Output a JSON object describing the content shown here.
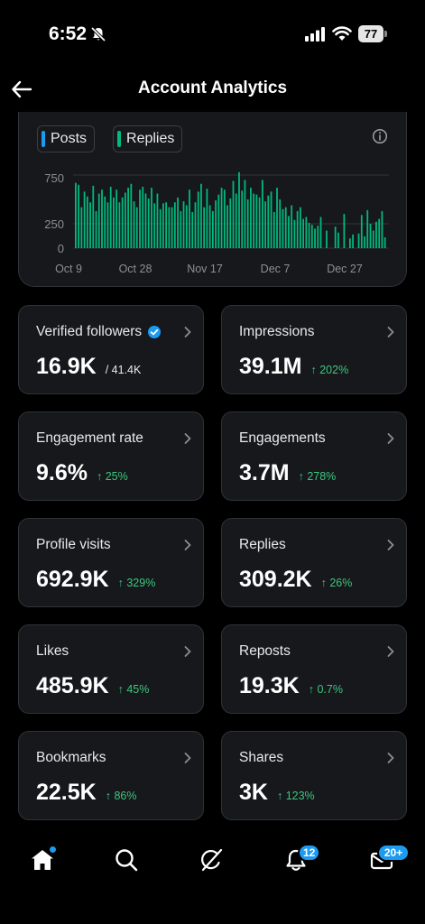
{
  "status_bar": {
    "time": "6:52",
    "battery": "77"
  },
  "header": {
    "title": "Account Analytics"
  },
  "chart": {
    "legend": [
      {
        "label": "Posts",
        "color": "#1d9bf0"
      },
      {
        "label": "Replies",
        "color": "#00ba7c"
      }
    ],
    "y_ticks": [
      "750",
      "250",
      "0"
    ],
    "x_ticks": [
      "Oct 9",
      "Oct 28",
      "Nov 17",
      "Dec 7",
      "Dec 27"
    ]
  },
  "chart_data": {
    "type": "bar",
    "title": "",
    "xlabel": "",
    "ylabel": "",
    "ylim": [
      0,
      750
    ],
    "x_tick_labels": [
      "Oct 9",
      "Oct 28",
      "Nov 17",
      "Dec 7",
      "Dec 27"
    ],
    "series": [
      {
        "name": "Posts",
        "color": "#1d9bf0",
        "values": [
          0,
          0,
          0,
          0,
          0,
          0,
          0,
          0,
          0,
          0,
          0,
          0,
          0,
          0,
          0,
          0,
          0,
          0,
          0,
          0,
          0,
          0,
          0,
          0,
          0,
          0,
          0,
          0,
          0,
          0,
          0,
          0,
          0,
          0,
          0,
          0,
          0,
          0,
          0,
          0,
          0,
          0,
          0,
          0,
          0,
          0,
          0,
          0,
          0,
          0,
          0,
          0,
          0,
          0,
          0,
          0,
          0,
          0,
          0,
          0,
          0,
          0,
          0,
          0,
          0,
          0,
          0,
          0,
          0,
          0,
          0,
          0,
          0,
          0,
          0,
          0,
          0,
          0,
          0,
          0,
          0,
          0,
          0,
          0,
          0,
          0,
          0,
          0,
          0,
          0,
          0,
          0,
          0,
          0
        ]
      },
      {
        "name": "Replies",
        "color": "#00ba7c",
        "values": [
          670,
          650,
          420,
          580,
          530,
          470,
          640,
          380,
          560,
          600,
          530,
          470,
          630,
          520,
          600,
          470,
          520,
          570,
          620,
          660,
          480,
          420,
          600,
          630,
          560,
          510,
          620,
          460,
          560,
          400,
          460,
          470,
          420,
          420,
          470,
          520,
          380,
          480,
          440,
          600,
          370,
          470,
          580,
          660,
          420,
          610,
          440,
          380,
          490,
          550,
          620,
          600,
          440,
          510,
          690,
          560,
          780,
          590,
          700,
          500,
          620,
          560,
          550,
          520,
          700,
          480,
          540,
          580,
          370,
          620,
          500,
          400,
          420,
          330,
          440,
          290,
          380,
          420,
          300,
          320,
          260,
          240,
          200,
          230,
          320,
          0,
          180,
          0,
          0,
          220,
          160,
          0,
          350,
          0,
          100,
          140,
          0,
          150,
          340,
          120,
          390,
          250,
          180,
          270,
          300,
          380,
          110
        ]
      }
    ]
  },
  "metrics": [
    {
      "label": "Verified followers",
      "value": "16.9K",
      "total": "/ 41.4K",
      "change": "",
      "verified": true
    },
    {
      "label": "Impressions",
      "value": "39.1M",
      "total": "",
      "change": "↑ 202%"
    },
    {
      "label": "Engagement rate",
      "value": "9.6%",
      "total": "",
      "change": "↑ 25%"
    },
    {
      "label": "Engagements",
      "value": "3.7M",
      "total": "",
      "change": "↑ 278%"
    },
    {
      "label": "Profile visits",
      "value": "692.9K",
      "total": "",
      "change": "↑ 329%"
    },
    {
      "label": "Replies",
      "value": "309.2K",
      "total": "",
      "change": "↑ 26%"
    },
    {
      "label": "Likes",
      "value": "485.9K",
      "total": "",
      "change": "↑ 45%"
    },
    {
      "label": "Reposts",
      "value": "19.3K",
      "total": "",
      "change": "↑ 0.7%"
    },
    {
      "label": "Bookmarks",
      "value": "22.5K",
      "total": "",
      "change": "↑ 86%"
    },
    {
      "label": "Shares",
      "value": "3K",
      "total": "",
      "change": "↑ 123%"
    }
  ],
  "nav": {
    "items": [
      "home-icon",
      "search-icon",
      "grok-icon",
      "notifications-icon",
      "messages-icon"
    ],
    "notifications_badge": "12",
    "messages_badge": "20+",
    "accent": "#1d9bf0"
  }
}
